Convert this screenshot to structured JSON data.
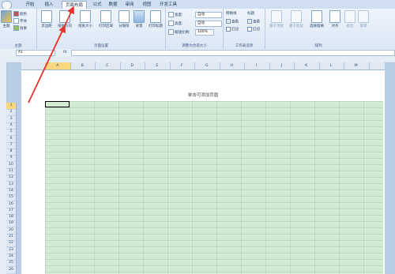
{
  "tabs": [
    "开始",
    "插入",
    "页面布局",
    "公式",
    "数据",
    "审阅",
    "视图",
    "开发工具"
  ],
  "active_tab": "页面布局",
  "ribbon": {
    "theme": {
      "group_label": "主题",
      "theme_button": "主题",
      "colors": "颜色",
      "fonts": "字体",
      "effects": "效果"
    },
    "page_setup": {
      "group_label": "页面设置",
      "margins": "页边距",
      "orientation": "纸张方向",
      "size": "纸张大小",
      "print_area": "打印区域",
      "breaks": "分隔符",
      "background": "背景",
      "print_titles": "打印标题"
    },
    "scale": {
      "group_label": "调整为合适大小",
      "width_label": "宽度:",
      "width_value": "自动",
      "height_label": "高度:",
      "height_value": "自动",
      "scale_label": "缩放比例:",
      "scale_value": "100%"
    },
    "sheet_options": {
      "group_label": "工作表选项",
      "gridlines": "网格线",
      "headings": "标题",
      "view": "查看",
      "print": "打印"
    },
    "arrange": {
      "group_label": "排列",
      "bring_forward": "置于顶层",
      "send_backward": "置于底层",
      "selection_pane": "选择窗格",
      "align": "对齐",
      "group": "组合",
      "rotate": "旋转"
    }
  },
  "formula_bar": {
    "name_box": "A1",
    "fx": "fx"
  },
  "columns": [
    "A",
    "B",
    "C",
    "D",
    "E",
    "F",
    "G",
    "H",
    "I",
    "J",
    "K",
    "L",
    "M"
  ],
  "rows": [
    "1",
    "2",
    "3",
    "4",
    "5",
    "6",
    "7",
    "8",
    "9",
    "10",
    "11",
    "12",
    "13",
    "14",
    "15",
    "16",
    "17",
    "18",
    "19",
    "20",
    "21",
    "22",
    "23",
    "24",
    "25",
    "26"
  ],
  "header_prompt": "单击可添加页眉",
  "colors": {
    "accent_arrow": "#e8322b",
    "grid_fill": "#d3ead3",
    "active_header": "#f9d77e"
  }
}
